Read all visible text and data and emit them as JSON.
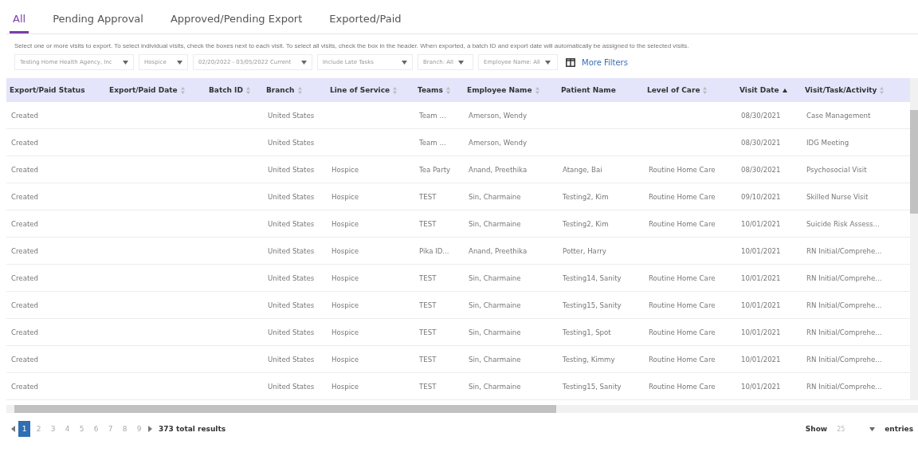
{
  "tabs": [
    {
      "label": "All",
      "selected": true
    },
    {
      "label": "Pending Approval",
      "selected": false
    },
    {
      "label": "Approved/Pending Export",
      "selected": false
    },
    {
      "label": "Exported/Paid",
      "selected": false
    }
  ],
  "instructions": "Select one or more visits to export. To select individual visits, check the boxes next to each visit. To select all visits, check the box in the header. When exported, a batch ID and export date will automatically be assigned to the selected visits.",
  "filters": [
    {
      "value": "Testing Home Health Agency, Inc",
      "kind": "select"
    },
    {
      "value": "Hospice",
      "kind": "select"
    },
    {
      "value": "02/20/2022 - 03/05/2022 Current",
      "kind": "select"
    },
    {
      "value": "Include Late Tasks",
      "kind": "select"
    },
    {
      "value": "Branch: All",
      "kind": "menu"
    },
    {
      "value": "Employee Name: All",
      "kind": "menu"
    }
  ],
  "more_filters": "More Filters",
  "table": {
    "columns": [
      {
        "label": "Export/Paid Status",
        "sortable": false,
        "sorted": false
      },
      {
        "label": "Export/Paid Date",
        "sortable": true,
        "sorted": false
      },
      {
        "label": "Batch ID",
        "sortable": true,
        "sorted": false
      },
      {
        "label": "Branch",
        "sortable": true,
        "sorted": false
      },
      {
        "label": "Line of Service",
        "sortable": true,
        "sorted": false
      },
      {
        "label": "Teams",
        "sortable": true,
        "sorted": false
      },
      {
        "label": "Employee Name",
        "sortable": true,
        "sorted": false
      },
      {
        "label": "Patient Name",
        "sortable": false,
        "sorted": false
      },
      {
        "label": "Level of Care",
        "sortable": true,
        "sorted": false
      },
      {
        "label": "Visit Date",
        "sortable": true,
        "sorted": true
      },
      {
        "label": "Visit/Task/Activity",
        "sortable": true,
        "sorted": false
      }
    ],
    "rows": [
      [
        "Created",
        "",
        "",
        "United States",
        "",
        "Team ...",
        "Amerson, Wendy",
        "",
        "",
        "08/30/2021",
        "Case Management"
      ],
      [
        "Created",
        "",
        "",
        "United States",
        "",
        "Team ...",
        "Amerson, Wendy",
        "",
        "",
        "08/30/2021",
        "IDG Meeting"
      ],
      [
        "Created",
        "",
        "",
        "United States",
        "Hospice",
        "Tea Party",
        "Anand, Preethika",
        "Atange, Bai",
        "Routine Home Care",
        "08/30/2021",
        "Psychosocial Visit"
      ],
      [
        "Created",
        "",
        "",
        "United States",
        "Hospice",
        "TEST",
        "Sin, Charmaine",
        "Testing2, Kim",
        "Routine Home Care",
        "09/10/2021",
        "Skilled Nurse Visit"
      ],
      [
        "Created",
        "",
        "",
        "United States",
        "Hospice",
        "TEST",
        "Sin, Charmaine",
        "Testing2, Kim",
        "Routine Home Care",
        "10/01/2021",
        "Suicide Risk Assess..."
      ],
      [
        "Created",
        "",
        "",
        "United States",
        "Hospice",
        "Pika ID...",
        "Anand, Preethika",
        "Potter, Harry",
        "",
        "10/01/2021",
        "RN Initial/Comprehe..."
      ],
      [
        "Created",
        "",
        "",
        "United States",
        "Hospice",
        "TEST",
        "Sin, Charmaine",
        "Testing14, Sanity",
        "Routine Home Care",
        "10/01/2021",
        "RN Initial/Comprehe..."
      ],
      [
        "Created",
        "",
        "",
        "United States",
        "Hospice",
        "TEST",
        "Sin, Charmaine",
        "Testing15, Sanity",
        "Routine Home Care",
        "10/01/2021",
        "RN Initial/Comprehe..."
      ],
      [
        "Created",
        "",
        "",
        "United States",
        "Hospice",
        "TEST",
        "Sin, Charmaine",
        "Testing1, Spot",
        "Routine Home Care",
        "10/01/2021",
        "RN Initial/Comprehe..."
      ],
      [
        "Created",
        "",
        "",
        "United States",
        "Hospice",
        "TEST",
        "Sin, Charmaine",
        "Testing, Kimmy",
        "Routine Home Care",
        "10/01/2021",
        "RN Initial/Comprehe..."
      ],
      [
        "Created",
        "",
        "",
        "United States",
        "Hospice",
        "TEST",
        "Sin, Charmaine",
        "Testing15, Sanity",
        "Routine Home Care",
        "10/01/2021",
        "RN Initial/Comprehe..."
      ]
    ]
  },
  "pagination": {
    "pages": [
      {
        "label": "1",
        "selected": true
      },
      {
        "label": "2",
        "selected": false
      },
      {
        "label": "3",
        "selected": false
      },
      {
        "label": "4",
        "selected": false
      },
      {
        "label": "5",
        "selected": false
      },
      {
        "label": "6",
        "selected": false
      },
      {
        "label": "7",
        "selected": false
      },
      {
        "label": "8",
        "selected": false
      },
      {
        "label": "9",
        "selected": false
      }
    ],
    "total": "373 total results"
  },
  "page_size": {
    "show": "Show",
    "value": "25",
    "entries": "entries"
  }
}
